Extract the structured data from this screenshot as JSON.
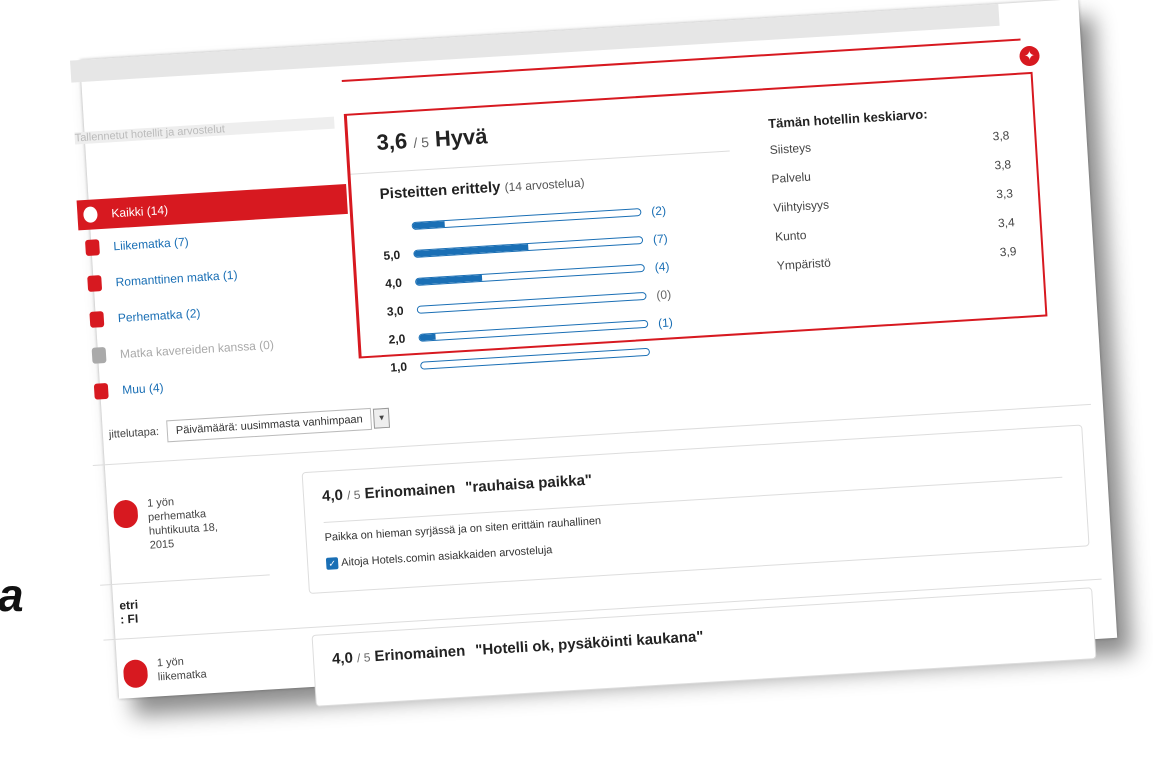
{
  "side_text": "a",
  "header": {
    "crumb": "Tallennetut hotellit ja arvostelut"
  },
  "filters": [
    {
      "label": "Kaikki (14)",
      "state": "active"
    },
    {
      "label": "Liikematka (7)",
      "state": "normal"
    },
    {
      "label": "Romanttinen matka (1)",
      "state": "normal"
    },
    {
      "label": "Perhematka (2)",
      "state": "normal"
    },
    {
      "label": "Matka kavereiden kanssa (0)",
      "state": "disabled"
    },
    {
      "label": "Muu (4)",
      "state": "normal"
    }
  ],
  "summary": {
    "score": "3,6",
    "of": "/ 5",
    "word": "Hyvä",
    "breakdown_title": "Pisteitten erittely",
    "breakdown_count": "(14 arvostelua)",
    "bars": [
      {
        "label": "",
        "count": "(2)",
        "fraction": 0.14
      },
      {
        "label": "5,0",
        "count": "(7)",
        "fraction": 0.5
      },
      {
        "label": "4,0",
        "count": "(4)",
        "fraction": 0.29
      },
      {
        "label": "3,0",
        "count": "(0)",
        "fraction": 0.0
      },
      {
        "label": "2,0",
        "count": "(1)",
        "fraction": 0.07
      },
      {
        "label": "1,0",
        "count": "",
        "fraction": 0.0
      }
    ],
    "averages_title": "Tämän hotellin keskiarvo:",
    "averages": [
      {
        "label": "Siisteys",
        "value": "3,8"
      },
      {
        "label": "Palvelu",
        "value": "3,8"
      },
      {
        "label": "Viihtyisyys",
        "value": "3,3"
      },
      {
        "label": "Kunto",
        "value": "3,4"
      },
      {
        "label": "Ympäristö",
        "value": "3,9"
      }
    ]
  },
  "sort": {
    "label": "jittelutapa:",
    "value": "Päivämäärä: uusimmasta vanhimpaan"
  },
  "reviews": [
    {
      "meta": [
        "1 yön",
        "perhematka",
        "huhtikuuta 18,",
        "2015"
      ],
      "name": [
        "etri",
        ": FI"
      ],
      "score": "4,0",
      "of": "/ 5",
      "word": "Erinomainen",
      "title": "\"rauhaisa paikka\"",
      "body": "Paikka on hieman syrjässä ja on siten erittäin rauhallinen",
      "source": "Aitoja Hotels.comin asiakkaiden arvosteluja"
    },
    {
      "meta": [
        "1 yön",
        "liikematka"
      ],
      "name": [],
      "score": "4,0",
      "of": "/ 5",
      "word": "Erinomainen",
      "title": "\"Hotelli ok, pysäköinti kaukana\"",
      "body": "",
      "source": ""
    }
  ],
  "colors": {
    "accent": "#d71920",
    "link": "#1a6fb5"
  }
}
